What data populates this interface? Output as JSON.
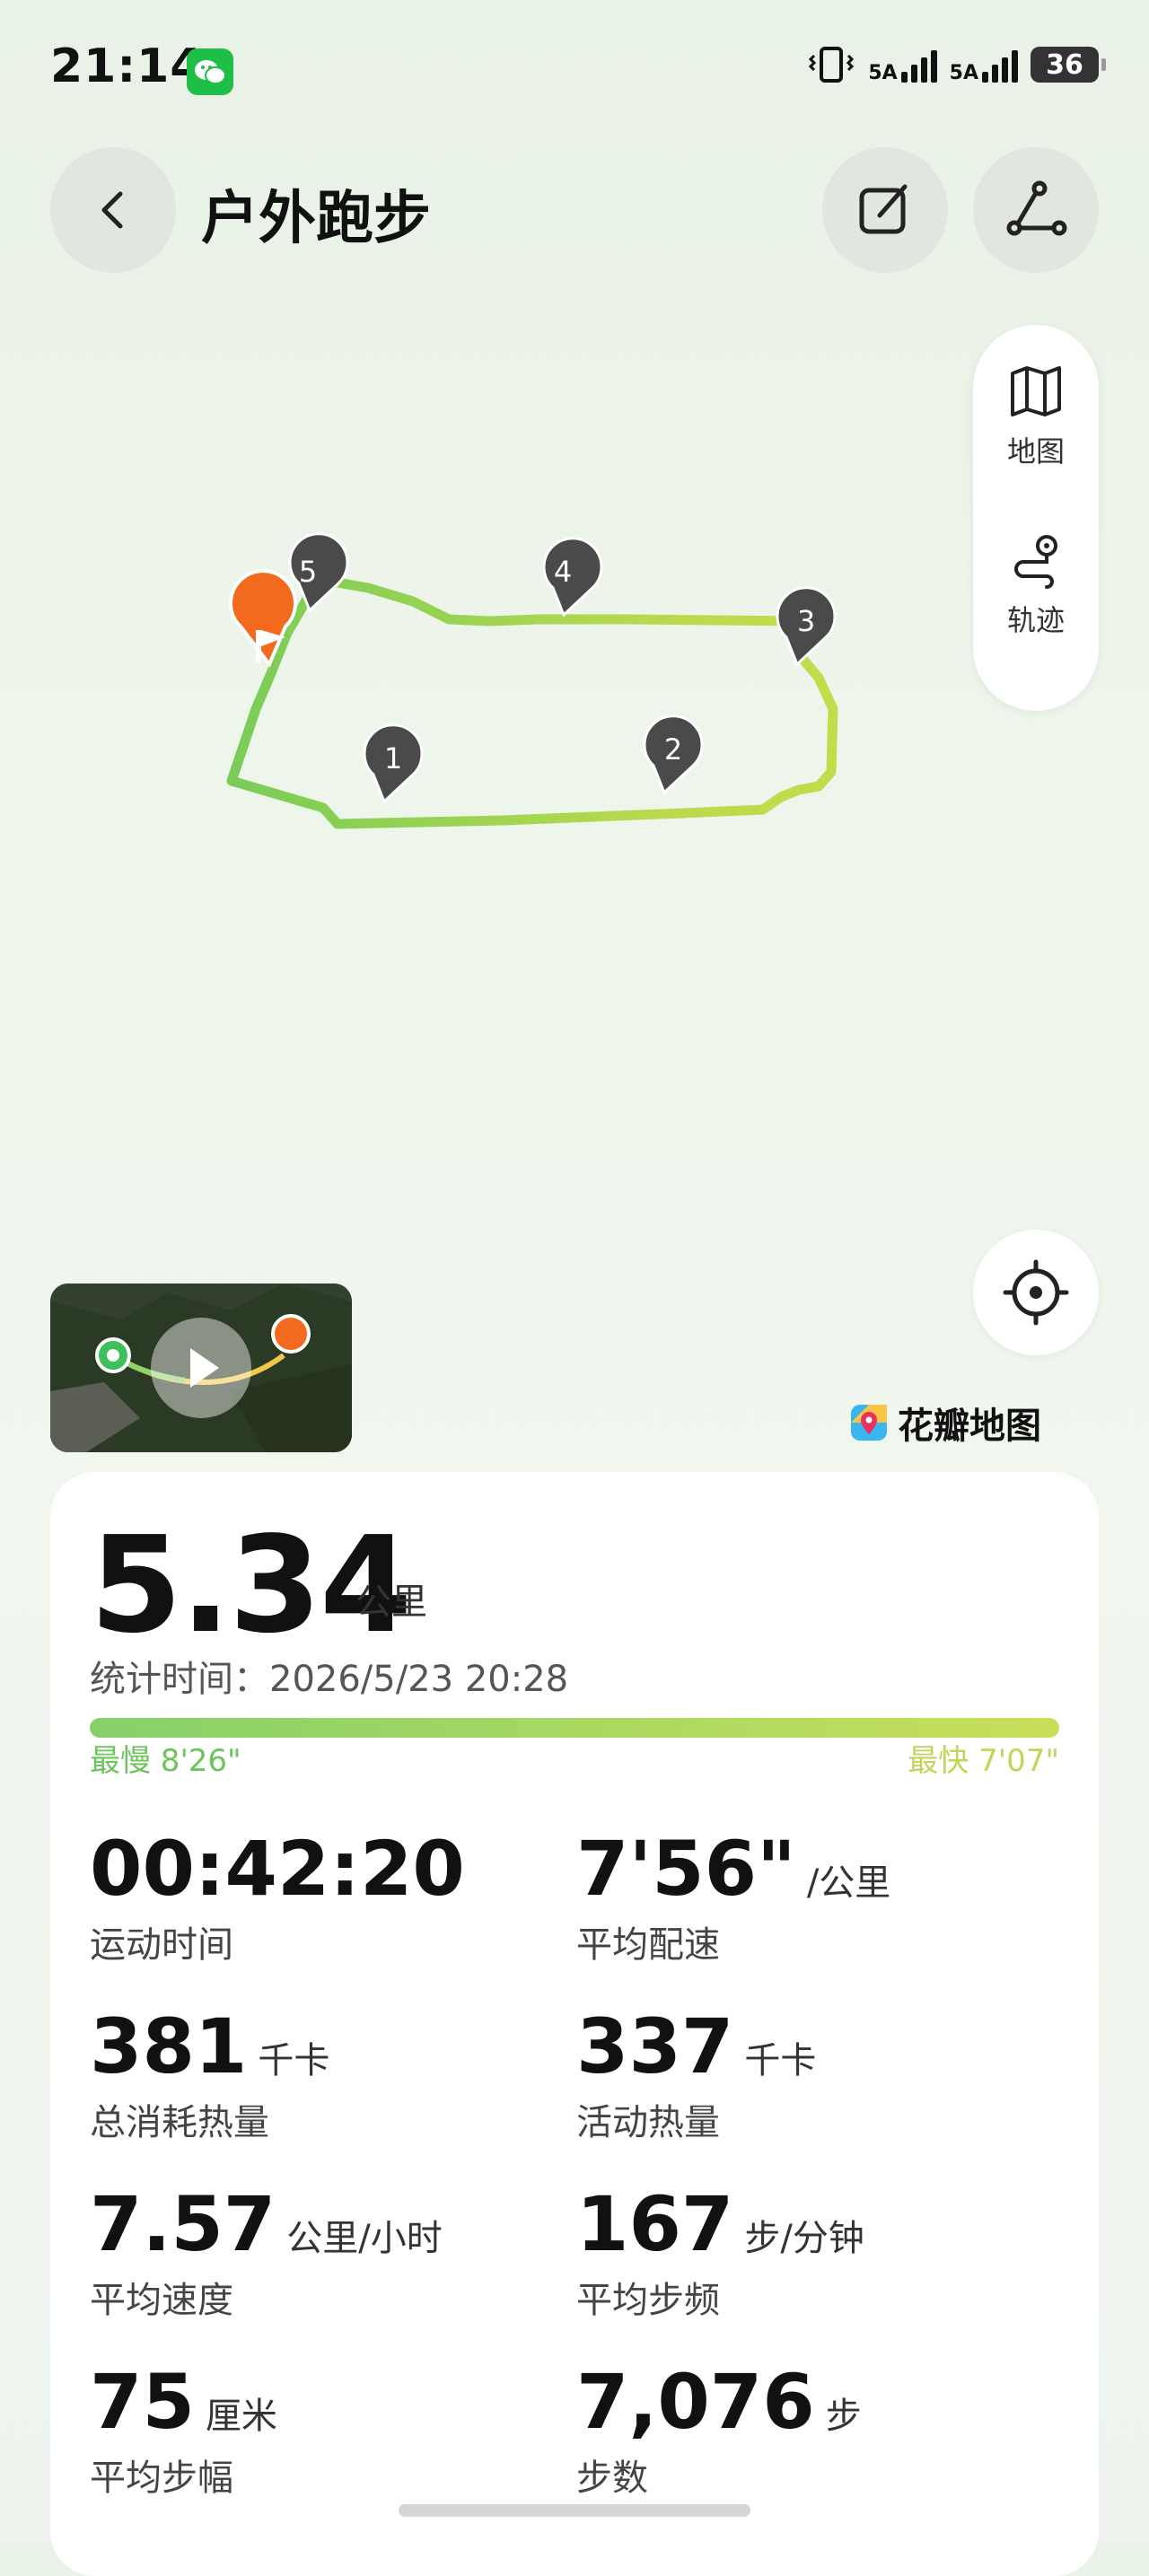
{
  "status_bar": {
    "time": "21:14",
    "network1": "5A",
    "network2": "5A",
    "battery": "36",
    "icons": [
      "wechat-icon",
      "vibrate-icon",
      "signal-icon",
      "signal-icon",
      "battery-icon"
    ]
  },
  "header": {
    "title": "户外跑步",
    "icons": [
      "back-icon",
      "edit-icon",
      "route-icon"
    ]
  },
  "map": {
    "markers": [
      "1",
      "2",
      "3",
      "4",
      "5"
    ],
    "panel": {
      "map_label": "地图",
      "track_label": "轨迹"
    },
    "brand": "花瓣地图",
    "colors": {
      "route_start": "#7ccf55",
      "route_end": "#c6de4a",
      "flag": "#f36a1e",
      "marker": "#4a4a4a"
    }
  },
  "summary": {
    "distance": "5.34",
    "distance_unit": "公里",
    "stat_time_label": "统计时间：",
    "stat_time_value": "2026/5/23 20:28",
    "pace_slowest": "最慢 8'26\"",
    "pace_fastest": "最快 7'07\""
  },
  "stats": [
    {
      "value": "00:42:20",
      "unit": "",
      "label": "运动时间"
    },
    {
      "value": "7'56\"",
      "unit": "/公里",
      "label": "平均配速"
    },
    {
      "value": "381",
      "unit": "千卡",
      "label": "总消耗热量"
    },
    {
      "value": "337",
      "unit": "千卡",
      "label": "活动热量"
    },
    {
      "value": "7.57",
      "unit": "公里/小时",
      "label": "平均速度"
    },
    {
      "value": "167",
      "unit": "步/分钟",
      "label": "平均步频"
    },
    {
      "value": "75",
      "unit": "厘米",
      "label": "平均步幅"
    },
    {
      "value": "7,076",
      "unit": "步",
      "label": "步数"
    }
  ]
}
